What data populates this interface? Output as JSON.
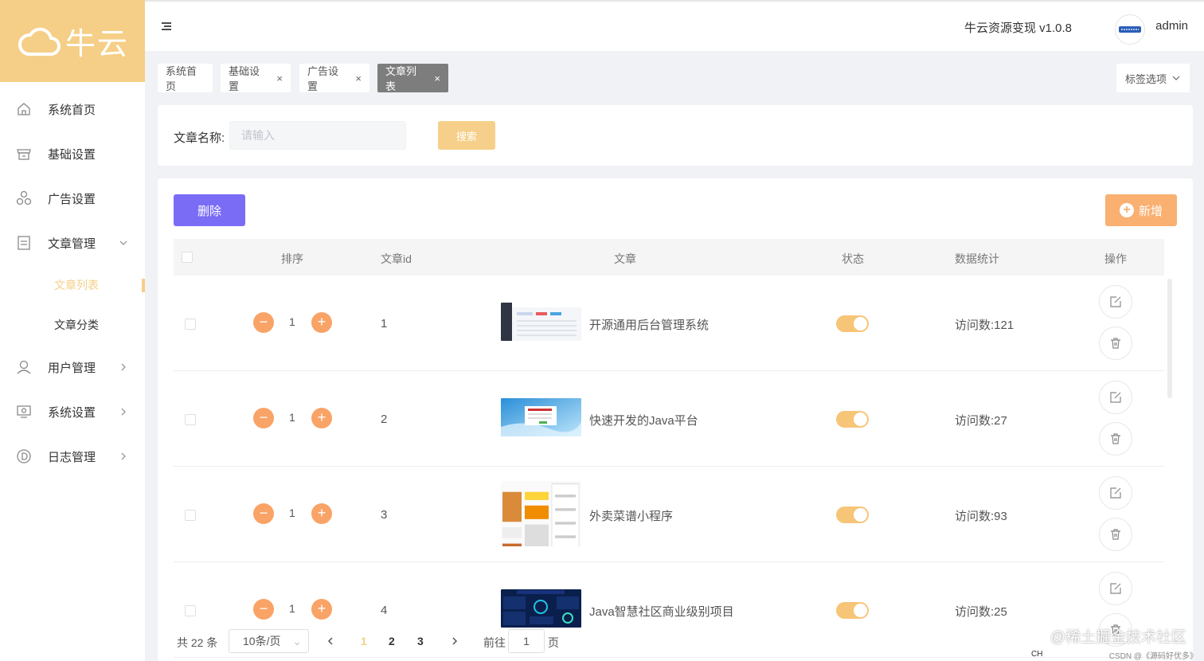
{
  "app": {
    "logo_text": "牛云",
    "version": "牛云资源变现 v1.0.8",
    "username": "admin"
  },
  "sidebar": {
    "items": [
      {
        "label": "系统首页",
        "icon": "home-icon"
      },
      {
        "label": "基础设置",
        "icon": "store-icon"
      },
      {
        "label": "广告设置",
        "icon": "circles-icon"
      },
      {
        "label": "文章管理",
        "icon": "document-icon",
        "expanded": true,
        "children": [
          {
            "label": "文章列表",
            "active": true
          },
          {
            "label": "文章分类"
          }
        ]
      },
      {
        "label": "用户管理",
        "icon": "user-icon"
      },
      {
        "label": "系统设置",
        "icon": "monitor-icon"
      },
      {
        "label": "日志管理",
        "icon": "log-icon"
      }
    ]
  },
  "tabs": [
    {
      "label": "系统首页",
      "closable": false
    },
    {
      "label": "基础设置",
      "closable": true
    },
    {
      "label": "广告设置",
      "closable": true
    },
    {
      "label": "文章列表",
      "closable": true,
      "active": true
    }
  ],
  "tab_close_glyph": "×",
  "tab_options_label": "标签选项",
  "search": {
    "label": "文章名称:",
    "placeholder": "请输入",
    "button": "搜索"
  },
  "actions": {
    "delete": "删除",
    "add": "新增"
  },
  "table": {
    "headers": {
      "sort": "排序",
      "id": "文章id",
      "article": "文章",
      "status": "状态",
      "stats": "数据统计",
      "ops": "操作"
    },
    "rows": [
      {
        "sort": "1",
        "id": "1",
        "title": "开源通用后台管理系统",
        "status_on": true,
        "stats": "访问数:121"
      },
      {
        "sort": "1",
        "id": "2",
        "title": "快速开发的Java平台",
        "status_on": true,
        "stats": "访问数:27"
      },
      {
        "sort": "1",
        "id": "3",
        "title": "外卖菜谱小程序",
        "status_on": true,
        "stats": "访问数:93"
      },
      {
        "sort": "1",
        "id": "4",
        "title": "Java智慧社区商业级别项目",
        "status_on": true,
        "stats": "访问数:25"
      }
    ]
  },
  "pagination": {
    "total": "共 22 条",
    "page_size": "10条/页",
    "pages": [
      "1",
      "2",
      "3"
    ],
    "current": "1",
    "goto_label": "前往",
    "goto_value": "1",
    "goto_suffix": "页"
  },
  "watermark": {
    "main": "@稀土掘金技术社区",
    "sub": "CSDN @《源码好优多》"
  },
  "tray_text": "CH",
  "colors": {
    "brand": "#f5cf87",
    "delete": "#7b6cf6",
    "add": "#f9b071",
    "stepper": "#f9a367",
    "toggle": "#f7c577"
  }
}
